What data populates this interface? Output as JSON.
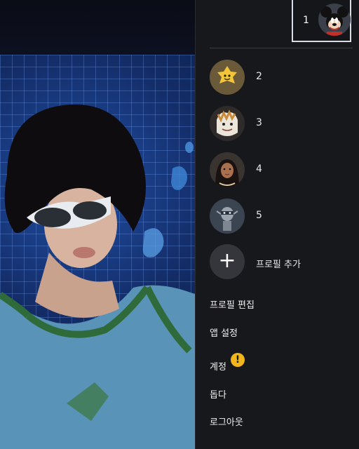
{
  "current_profile": {
    "number": "1",
    "avatar": "mickey-mouse-avatar"
  },
  "profiles": [
    {
      "number": "2",
      "avatar": "yellow-star-avatar"
    },
    {
      "number": "3",
      "avatar": "white-creature-avatar"
    },
    {
      "number": "4",
      "avatar": "moana-avatar"
    },
    {
      "number": "5",
      "avatar": "robot-avatar"
    }
  ],
  "add_profile": {
    "label": "프로필 추가",
    "icon": "plus-icon"
  },
  "menu": {
    "edit_profile": "프로필 편집",
    "app_settings": "앱 설정",
    "account": "계정",
    "account_alert": "!",
    "help": "돕다",
    "logout": "로그아웃"
  },
  "colors": {
    "panel_bg": "#17181b",
    "alert": "#f3b51c",
    "selected_border": "#d8dde6"
  }
}
